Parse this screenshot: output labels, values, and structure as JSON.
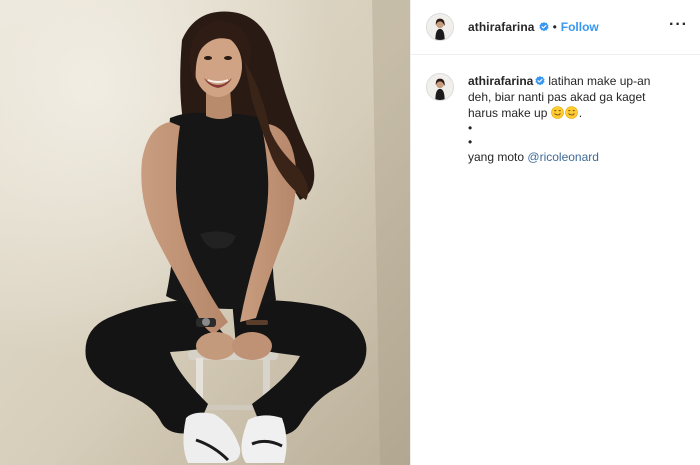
{
  "post": {
    "header": {
      "username": "athirafarina",
      "separator": "•",
      "follow_label": "Follow",
      "more_label": "···"
    },
    "caption": {
      "username": "athirafarina",
      "line1": "latihan make up-an",
      "line2": "deh, biar nanti pas akad ga kaget",
      "line3": "harus make up",
      "line3_end": ".",
      "bullet1": "•",
      "bullet2": "•",
      "credit_prefix": "yang moto",
      "mention": "@ricoleonard"
    },
    "icons": {
      "avatar": "profile-avatar-icon",
      "verified": "verified-badge-icon",
      "emoji": "savoring-food-face-emoji",
      "more": "more-options-icon"
    },
    "colors": {
      "follow": "#3897f0",
      "mention": "#3d6a98",
      "verified": "#3897f0",
      "text": "#262626"
    }
  }
}
